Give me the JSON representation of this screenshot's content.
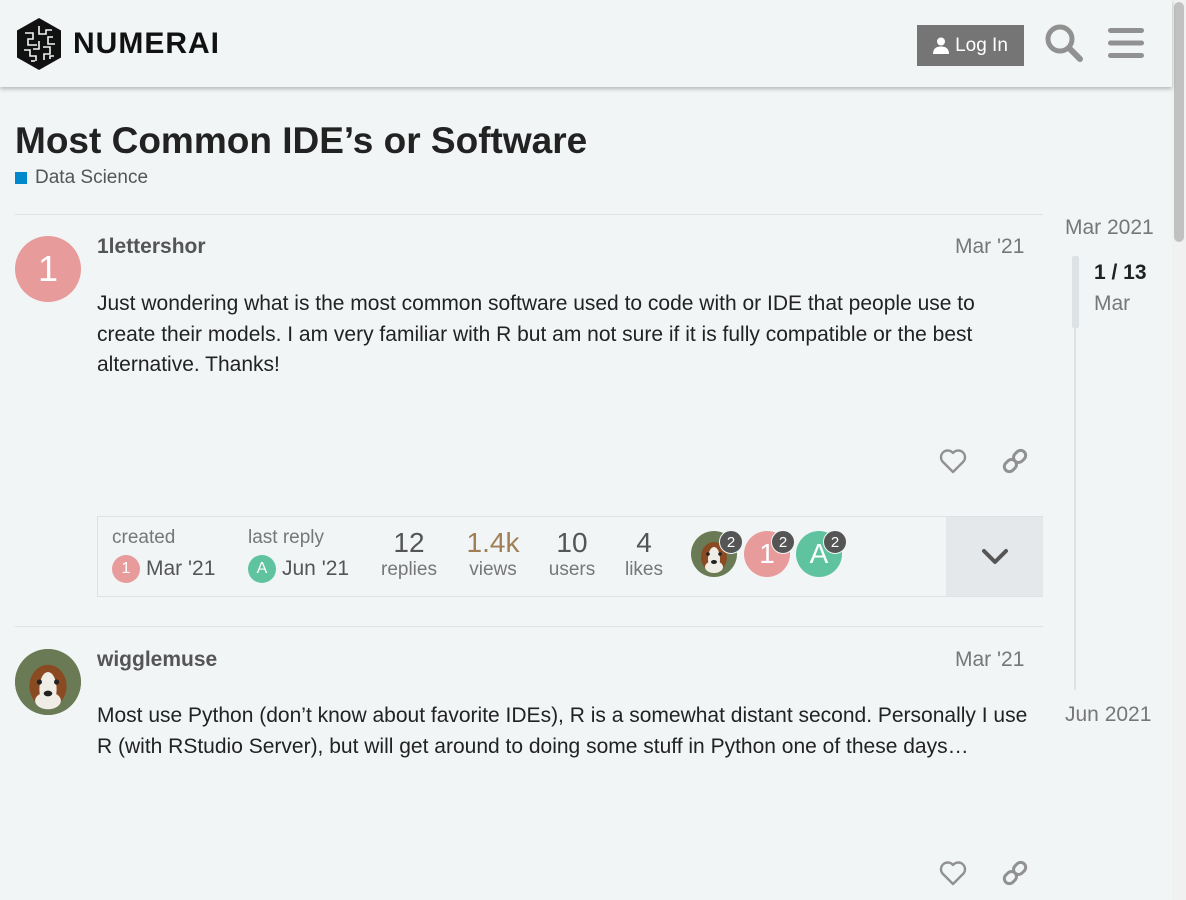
{
  "header": {
    "brand": "NUMERAI",
    "login_label": "Log In",
    "icons": [
      "search-icon",
      "hamburger-menu-icon",
      "user-icon"
    ]
  },
  "topic": {
    "title": "Most Common IDE’s or Software",
    "category": "Data Science",
    "category_color": "#0088cc"
  },
  "posts": [
    {
      "username": "1lettershor",
      "avatar_letter": "1",
      "avatar_color": "#e89b9b",
      "date": "Mar '21",
      "body": "Just wondering what is the most common software used to code with or IDE that people use to create their models. I am very familiar with R but am not sure if it is fully compatible or the best alternative. Thanks!"
    },
    {
      "username": "wigglemuse",
      "date": "Mar '21",
      "body": "Most use Python (don’t know about favorite IDEs), R is a somewhat distant second. Personally I use R (with RStudio Server), but will get around to doing some stuff in Python one of these days…"
    }
  ],
  "topic_map": {
    "created_label": "created",
    "created_date": "Mar '21",
    "created_avatar_letter": "1",
    "last_reply_label": "last reply",
    "last_reply_date": "Jun '21",
    "last_reply_avatar_letter": "A",
    "replies": "12",
    "replies_label": "replies",
    "views": "1.4k",
    "views_label": "views",
    "users": "10",
    "users_label": "users",
    "likes": "4",
    "likes_label": "likes",
    "participants": [
      {
        "kind": "dog",
        "count": "2"
      },
      {
        "letter": "1",
        "color": "#e89b9b",
        "count": "2"
      },
      {
        "letter": "A",
        "color": "#5fc3a0",
        "count": "2"
      }
    ]
  },
  "timeline": {
    "start": "Mar 2021",
    "position": "1 / 13",
    "month": "Mar",
    "end": "Jun 2021"
  }
}
